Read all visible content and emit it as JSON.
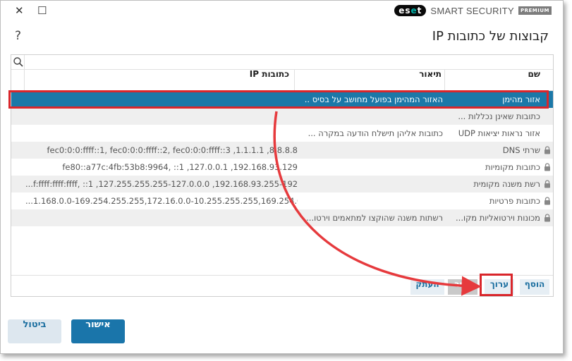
{
  "window": {
    "close_glyph": "✕",
    "maximize_glyph": "☐",
    "brand": {
      "logo_part1": "es",
      "logo_part2": "e",
      "logo_part3": "t",
      "product": "SMART SECURITY",
      "edition": "PREMIUM"
    }
  },
  "header": {
    "title": "קבוצות של כתובות IP",
    "help": "?"
  },
  "search": {
    "placeholder": ""
  },
  "table": {
    "columns": {
      "name": "שם",
      "description": "תיאור",
      "ip": "כתובות IP"
    },
    "rows": [
      {
        "name": "אזור מהימן",
        "description": "האזור המהימן בפועל מחושב על בסיס ...",
        "ip": "",
        "locked": false,
        "selected": true
      },
      {
        "name": "כתובות שאינן נכללות ...",
        "description": "",
        "ip": "",
        "locked": false
      },
      {
        "name": "אזור נראות יציאות UDP",
        "description": "כתובות אליהן תישלח הודעה במקרה ...",
        "ip": "",
        "locked": false
      },
      {
        "name": "שרתי DNS",
        "description": "",
        "ip": "fec0:0:0:ffff::1, fec0:0:0:ffff::2, fec0:0:0:ffff::3 ,1.1.1.1 ,8.8.8.8",
        "locked": true
      },
      {
        "name": "כתובות מקומיות",
        "description": "",
        "ip": "fe80::a77c:4fb:53b8:9964, ::1 ,127.0.0.1 ,192.168.93.129",
        "locked": true
      },
      {
        "name": "רשת משנה מקומית",
        "description": "",
        "ip": "...f:ffff:ffff:ffff, ::1 ,127.255.255.255-127.0.0.0 ,192.168.93.255-192.168.93.0",
        "locked": true
      },
      {
        "name": "כתובות פרטיות",
        "description": "",
        "ip": "...1.168.0.0-169.254.255.255,172.16.0.0-10.255.255.255,169.254.0.0-10.0.0.0",
        "locked": true
      },
      {
        "name": "מכונות וירטואליות מקו...",
        "description": "רשתות משנה שהוקצו למתאמים וירטו...",
        "ip": "",
        "locked": true
      }
    ]
  },
  "toolbar": {
    "add": "הוסף",
    "edit": "ערוך",
    "delete": "הסר",
    "copy": "העתק"
  },
  "dialog": {
    "ok": "אישור",
    "cancel": "ביטול"
  },
  "colors": {
    "selection": "#1b78a8",
    "annotation": "#d9262b",
    "primary": "#1a75aa"
  }
}
